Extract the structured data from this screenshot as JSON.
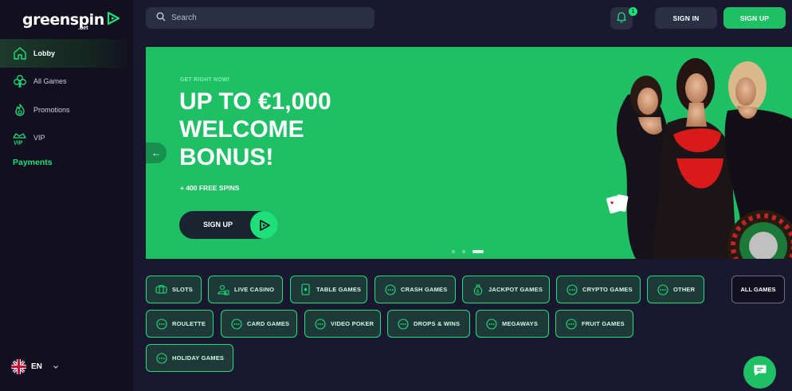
{
  "brand": {
    "name": "greenspin",
    "suffix": ".bet"
  },
  "sidebar": {
    "items": [
      {
        "label": "Lobby",
        "icon": "home-icon"
      },
      {
        "label": "All Games",
        "icon": "clubs-icon"
      },
      {
        "label": "Promotions",
        "icon": "fire-icon"
      },
      {
        "label": "VIP",
        "icon": "crown-vip-icon"
      }
    ],
    "payments_label": "Payments",
    "language": "EN"
  },
  "header": {
    "search_placeholder": "Search",
    "notification_count": "1",
    "signin_label": "SIGN IN",
    "signup_label": "SIGN UP"
  },
  "banner": {
    "eyebrow": "GET RIGHT NOW!",
    "headline": "UP TO €1,000 WELCOME BONUS!",
    "subline": "+ 400 FREE SPINS",
    "cta_label": "SIGN UP",
    "prev_arrow": "←",
    "next_arrow": "→",
    "slide_count": 3,
    "active_slide": 3
  },
  "categories": [
    {
      "label": "SLOTS",
      "icon": "slots-icon"
    },
    {
      "label": "LIVE CASINO",
      "icon": "live-dealer-icon"
    },
    {
      "label": "TABLE GAMES",
      "icon": "card-icon"
    },
    {
      "label": "CRASH GAMES",
      "icon": "dots-icon"
    },
    {
      "label": "JACKPOT GAMES",
      "icon": "money-bag-icon"
    },
    {
      "label": "CRYPTO GAMES",
      "icon": "dots-icon"
    },
    {
      "label": "OTHER",
      "icon": "dots-icon"
    },
    {
      "label": "ROULETTE",
      "icon": "dots-icon"
    },
    {
      "label": "CARD GAMES",
      "icon": "dots-icon"
    },
    {
      "label": "VIDEO POKER",
      "icon": "dots-icon"
    },
    {
      "label": "DROPS & WINS",
      "icon": "dots-icon"
    },
    {
      "label": "MEGAWAYS",
      "icon": "dots-icon"
    },
    {
      "label": "FRUIT GAMES",
      "icon": "dots-icon"
    },
    {
      "label": "HOLIDAY GAMES",
      "icon": "dots-icon"
    }
  ],
  "all_games_label": "ALL GAMES",
  "colors": {
    "accent": "#1ee07a",
    "banner_green": "#1fbf66",
    "background": "#1a1730",
    "sidebar": "#12101f"
  }
}
